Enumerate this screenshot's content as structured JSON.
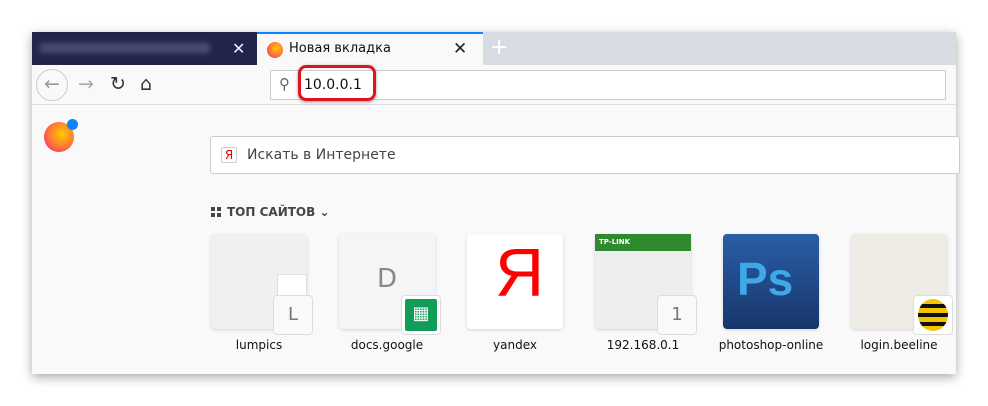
{
  "tabs": [
    {
      "label": "",
      "state": "inactive"
    },
    {
      "label": "Новая вкладка",
      "state": "active"
    }
  ],
  "toolbar": {
    "url_value": "10.0.0.1"
  },
  "search": {
    "placeholder": "Искать в Интернете",
    "engine_icon": "Я"
  },
  "top_sites": {
    "heading": "ТОП САЙТОВ",
    "sites": [
      {
        "label": "lumpics",
        "badge": "L"
      },
      {
        "label": "docs.google",
        "badge": ""
      },
      {
        "label": "yandex",
        "badge": ""
      },
      {
        "label": "192.168.0.1",
        "badge": "1"
      },
      {
        "label": "photoshop-online",
        "badge": ""
      },
      {
        "label": "login.beeline",
        "badge": ""
      }
    ]
  },
  "thumb_text": {
    "docs": "D",
    "yandex": "Я",
    "tplink": "TP-LINK",
    "ps": "Ps"
  },
  "colors": {
    "accent": "#0a84ff",
    "highlight": "#e0141e"
  }
}
